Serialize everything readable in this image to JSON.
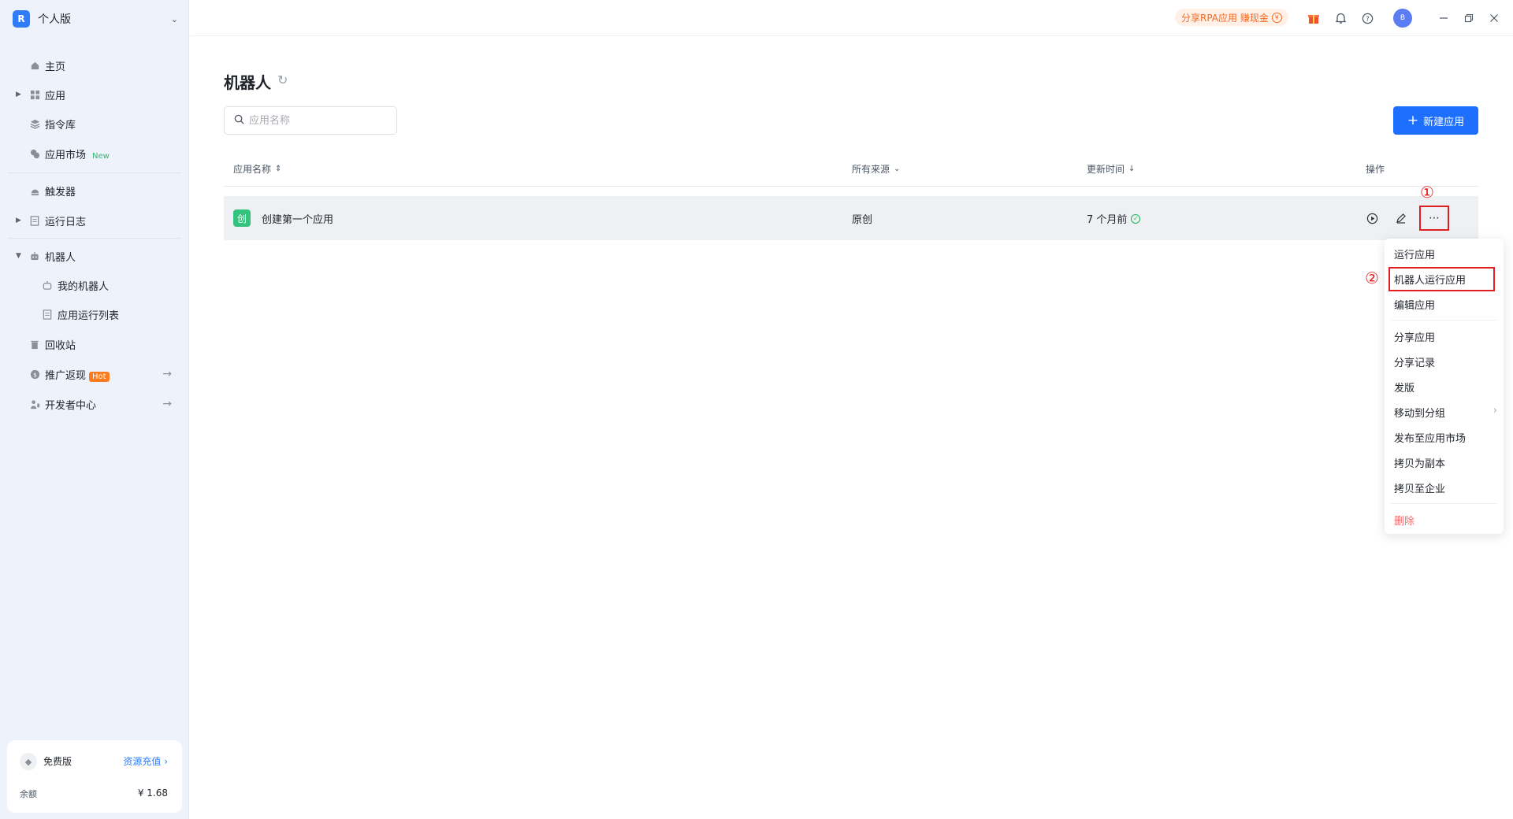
{
  "workspace": {
    "logo": "R",
    "name": "个人版"
  },
  "sidebar": {
    "items": [
      {
        "label": "主页",
        "icon": "home-icon"
      },
      {
        "label": "应用",
        "icon": "apps-icon"
      },
      {
        "label": "指令库",
        "icon": "layers-icon"
      },
      {
        "label": "应用市场",
        "icon": "market-icon",
        "badge": "New"
      },
      {
        "label": "触发器",
        "icon": "trigger-icon"
      },
      {
        "label": "运行日志",
        "icon": "log-icon"
      },
      {
        "label": "机器人",
        "icon": "robot-icon"
      },
      {
        "label": "我的机器人",
        "icon": "robot-icon"
      },
      {
        "label": "应用运行列表",
        "icon": "list-icon"
      },
      {
        "label": "回收站",
        "icon": "trash-icon"
      },
      {
        "label": "推广返现",
        "icon": "coin-icon",
        "badge": "Hot"
      },
      {
        "label": "开发者中心",
        "icon": "developer-icon"
      }
    ]
  },
  "plan": {
    "name": "免费版",
    "recharge": "资源充值 ›",
    "balance_label": "余额",
    "balance_value": "¥ 1.68"
  },
  "topbar": {
    "promo": "分享RPA应用 赚现金",
    "avatar": "B"
  },
  "main": {
    "title": "机器人",
    "search_placeholder": "应用名称",
    "new_button": "新建应用",
    "columns": {
      "name": "应用名称",
      "source": "所有来源",
      "updated": "更新时间",
      "actions": "操作"
    },
    "rows": [
      {
        "icon_char": "创",
        "name": "创建第一个应用",
        "source": "原创",
        "updated": "7 个月前"
      }
    ]
  },
  "annotations": {
    "first": "①",
    "second": "②"
  },
  "menu": {
    "items": [
      "运行应用",
      "机器人运行应用",
      "编辑应用",
      "分享应用",
      "分享记录",
      "发版",
      "移动到分组",
      "发布至应用市场",
      "拷贝为副本",
      "拷贝至企业",
      "删除"
    ]
  },
  "colors": {
    "primary": "#1f6fff",
    "annotation": "#e02020",
    "danger": "#f56c6c",
    "sidebar_bg": "#eef2fb"
  }
}
